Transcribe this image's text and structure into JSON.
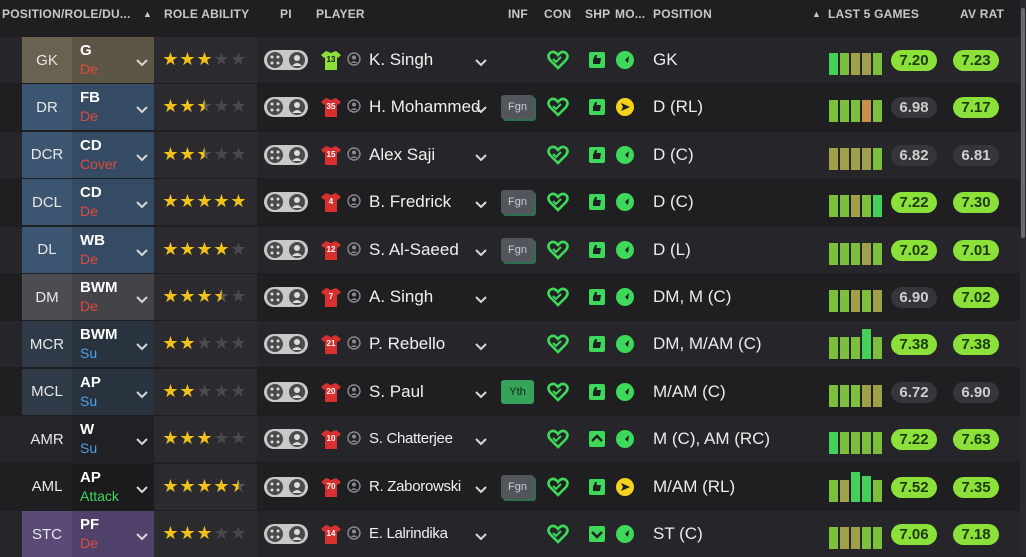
{
  "columns": {
    "position_role_duty": "POSITION/ROLE/DU...",
    "role_ability": "ROLE ABILITY",
    "pi": "PI",
    "player": "PLAYER",
    "inf": "INF",
    "con": "CON",
    "shp": "SHP",
    "mo": "MO...",
    "position": "POSITION",
    "last5": "LAST 5 GAMES",
    "avrat": "AV RAT"
  },
  "colors": {
    "duty_defend": "#e04a3c",
    "duty_support": "#4aa0e8",
    "duty_attack": "#3ed85a",
    "star": "#f2c21b",
    "icon_green": "#3ed85a",
    "morale_yellow": "#f2d21b",
    "rating_green": "#8ce03a"
  },
  "rows": [
    {
      "pos": "GK",
      "role": "G",
      "duty": "De",
      "duty_type": "defend",
      "pos_color": "#6a6250",
      "stars": 3,
      "pi_on": false,
      "shirt": "13",
      "shirt_color": "#8ce03a",
      "name": "K. Singh",
      "inf": "",
      "con": "heart",
      "shp": "thumb",
      "mo": "arrow-green",
      "position": "GK",
      "last5": [
        {
          "v": 0.72,
          "c": "#43d15a"
        },
        {
          "v": 0.72,
          "c": "#7bbf3c"
        },
        {
          "v": 0.72,
          "c": "#a0a04a"
        },
        {
          "v": 0.72,
          "c": "#a0a04a"
        },
        {
          "v": 0.72,
          "c": "#7bbf3c"
        }
      ],
      "rating": "7.20",
      "rating_style": "green",
      "av": "7.23",
      "av_style": "green"
    },
    {
      "pos": "DR",
      "role": "FB",
      "duty": "De",
      "duty_type": "defend",
      "pos_color": "#3c5570",
      "stars": 2.5,
      "pi_on": false,
      "shirt": "35",
      "shirt_color": "#d8302e",
      "name": "H. Mohammed",
      "inf": "Fgn",
      "con": "heart",
      "shp": "thumb",
      "mo": "arrow-yellow",
      "position": "D (RL)",
      "last5": [
        {
          "v": 0.72,
          "c": "#7bbf3c"
        },
        {
          "v": 0.72,
          "c": "#7bbf3c"
        },
        {
          "v": 0.72,
          "c": "#7bbf3c"
        },
        {
          "v": 0.72,
          "c": "#c8904a"
        },
        {
          "v": 0.72,
          "c": "#7bbf3c"
        }
      ],
      "rating": "6.98",
      "rating_style": "grey",
      "av": "7.17",
      "av_style": "green"
    },
    {
      "pos": "DCR",
      "role": "CD",
      "duty": "Cover",
      "duty_type": "defend",
      "pos_color": "#3c5570",
      "stars": 2.5,
      "pi_on": false,
      "shirt": "15",
      "shirt_color": "#d8302e",
      "name": "Alex Saji",
      "inf": "",
      "con": "heart",
      "shp": "thumb",
      "mo": "arrow-green",
      "position": "D (C)",
      "last5": [
        {
          "v": 0.72,
          "c": "#a0a04a"
        },
        {
          "v": 0.72,
          "c": "#a0a04a"
        },
        {
          "v": 0.72,
          "c": "#a0a04a"
        },
        {
          "v": 0.72,
          "c": "#a0a04a"
        },
        {
          "v": 0.72,
          "c": "#7bbf3c"
        }
      ],
      "rating": "6.82",
      "rating_style": "grey",
      "av": "6.81",
      "av_style": "grey"
    },
    {
      "pos": "DCL",
      "role": "CD",
      "duty": "De",
      "duty_type": "defend",
      "pos_color": "#3c5570",
      "stars": 5,
      "pi_on": false,
      "shirt": "4",
      "shirt_color": "#d8302e",
      "name": "B. Fredrick",
      "inf": "Fgn",
      "con": "heart",
      "shp": "thumb",
      "mo": "arrow-green",
      "position": "D (C)",
      "last5": [
        {
          "v": 0.72,
          "c": "#7bbf3c"
        },
        {
          "v": 0.72,
          "c": "#7bbf3c"
        },
        {
          "v": 0.72,
          "c": "#a0a04a"
        },
        {
          "v": 0.72,
          "c": "#7bbf3c"
        },
        {
          "v": 0.72,
          "c": "#43d15a"
        }
      ],
      "rating": "7.22",
      "rating_style": "green",
      "av": "7.30",
      "av_style": "green"
    },
    {
      "pos": "DL",
      "role": "WB",
      "duty": "De",
      "duty_type": "defend",
      "pos_color": "#3c5570",
      "stars": 4,
      "pi_on": false,
      "shirt": "12",
      "shirt_color": "#d8302e",
      "name": "S. Al-Saeed",
      "inf": "Fgn",
      "con": "heart",
      "shp": "thumb",
      "mo": "arrow-green",
      "position": "D (L)",
      "last5": [
        {
          "v": 0.72,
          "c": "#7bbf3c"
        },
        {
          "v": 0.72,
          "c": "#7bbf3c"
        },
        {
          "v": 0.72,
          "c": "#7bbf3c"
        },
        {
          "v": 0.72,
          "c": "#a0a04a"
        },
        {
          "v": 0.72,
          "c": "#7bbf3c"
        }
      ],
      "rating": "7.02",
      "rating_style": "green",
      "av": "7.01",
      "av_style": "green"
    },
    {
      "pos": "DM",
      "role": "BWM",
      "duty": "De",
      "duty_type": "defend",
      "pos_color": "#4c4c52",
      "stars": 3.5,
      "pi_on": false,
      "shirt": "7",
      "shirt_color": "#d8302e",
      "name": "A. Singh",
      "inf": "",
      "con": "heart",
      "shp": "thumb",
      "mo": "arrow-green",
      "position": "DM, M (C)",
      "last5": [
        {
          "v": 0.72,
          "c": "#7bbf3c"
        },
        {
          "v": 0.72,
          "c": "#7bbf3c"
        },
        {
          "v": 0.72,
          "c": "#a0a04a"
        },
        {
          "v": 0.72,
          "c": "#7bbf3c"
        },
        {
          "v": 0.72,
          "c": "#a0a04a"
        }
      ],
      "rating": "6.90",
      "rating_style": "grey",
      "av": "7.02",
      "av_style": "green"
    },
    {
      "pos": "MCR",
      "role": "BWM",
      "duty": "Su",
      "duty_type": "support",
      "pos_color": "#2f3a48",
      "stars": 2,
      "pi_on": false,
      "shirt": "21",
      "shirt_color": "#d8302e",
      "name": "P. Rebello",
      "inf": "",
      "con": "heart",
      "shp": "thumb",
      "mo": "arrow-green",
      "position": "DM, M/AM (C)",
      "last5": [
        {
          "v": 0.72,
          "c": "#7bbf3c"
        },
        {
          "v": 0.72,
          "c": "#7bbf3c"
        },
        {
          "v": 0.72,
          "c": "#7bbf3c"
        },
        {
          "v": 1.0,
          "c": "#43d15a"
        },
        {
          "v": 0.72,
          "c": "#7bbf3c"
        }
      ],
      "rating": "7.38",
      "rating_style": "green",
      "av": "7.38",
      "av_style": "green"
    },
    {
      "pos": "MCL",
      "role": "AP",
      "duty": "Su",
      "duty_type": "support",
      "pos_color": "#2f3a48",
      "stars": 2,
      "pi_on": false,
      "shirt": "20",
      "shirt_color": "#d8302e",
      "name": "S. Paul",
      "inf": "Yth",
      "con": "heart",
      "shp": "thumb",
      "mo": "arrow-green",
      "position": "M/AM (C)",
      "last5": [
        {
          "v": 0.72,
          "c": "#7bbf3c"
        },
        {
          "v": 0.72,
          "c": "#7bbf3c"
        },
        {
          "v": 0.72,
          "c": "#7bbf3c"
        },
        {
          "v": 0.72,
          "c": "#a0a04a"
        },
        {
          "v": 0.72,
          "c": "#a0a04a"
        }
      ],
      "rating": "6.72",
      "rating_style": "grey",
      "av": "6.90",
      "av_style": "grey"
    },
    {
      "pos": "AMR",
      "role": "W",
      "duty": "Su",
      "duty_type": "support",
      "pos_color": "#26262a",
      "stars": 3,
      "pi_on": false,
      "shirt": "10",
      "shirt_color": "#d8302e",
      "name": "S. Chatterjee",
      "inf": "",
      "con": "heart",
      "shp": "chevron-up",
      "mo": "arrow-green",
      "position": "M (C), AM (RC)",
      "last5": [
        {
          "v": 0.72,
          "c": "#43d15a"
        },
        {
          "v": 0.72,
          "c": "#7bbf3c"
        },
        {
          "v": 0.72,
          "c": "#7bbf3c"
        },
        {
          "v": 0.72,
          "c": "#7bbf3c"
        },
        {
          "v": 0.72,
          "c": "#7bbf3c"
        }
      ],
      "rating": "7.22",
      "rating_style": "green",
      "av": "7.63",
      "av_style": "green"
    },
    {
      "pos": "AML",
      "role": "AP",
      "duty": "Attack",
      "duty_type": "attack",
      "pos_color": "#1f1f22",
      "stars": 4.5,
      "pi_on": false,
      "shirt": "70",
      "shirt_color": "#d8302e",
      "name": "R. Zaborowski",
      "inf": "Fgn",
      "con": "heart",
      "shp": "thumb",
      "mo": "arrow-yellow",
      "position": "M/AM (RL)",
      "last5": [
        {
          "v": 0.72,
          "c": "#7bbf3c"
        },
        {
          "v": 0.72,
          "c": "#a0a04a"
        },
        {
          "v": 1.0,
          "c": "#43d15a"
        },
        {
          "v": 0.86,
          "c": "#43d15a"
        },
        {
          "v": 0.72,
          "c": "#7bbf3c"
        }
      ],
      "rating": "7.52",
      "rating_style": "green",
      "av": "7.35",
      "av_style": "green"
    },
    {
      "pos": "STC",
      "role": "PF",
      "duty": "De",
      "duty_type": "defend",
      "pos_color": "#5a4a78",
      "stars": 3,
      "pi_on": false,
      "shirt": "14",
      "shirt_color": "#d8302e",
      "name": "E. Lalrindika",
      "inf": "",
      "con": "heart",
      "shp": "chevron-down",
      "mo": "arrow-green",
      "position": "ST (C)",
      "last5": [
        {
          "v": 0.72,
          "c": "#7bbf3c"
        },
        {
          "v": 0.72,
          "c": "#a0a04a"
        },
        {
          "v": 0.72,
          "c": "#a0a04a"
        },
        {
          "v": 0.72,
          "c": "#7bbf3c"
        },
        {
          "v": 0.72,
          "c": "#7bbf3c"
        }
      ],
      "rating": "7.06",
      "rating_style": "green",
      "av": "7.18",
      "av_style": "green"
    }
  ]
}
